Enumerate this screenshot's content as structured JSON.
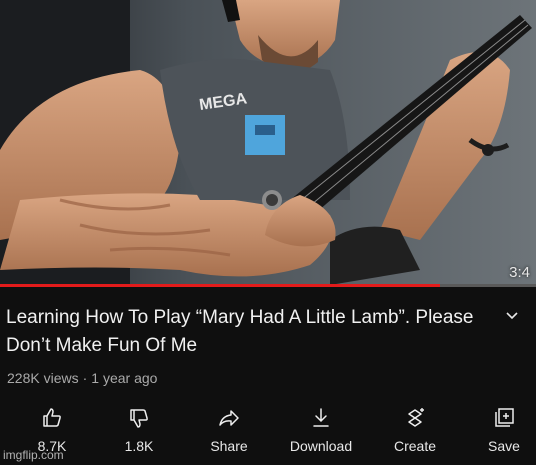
{
  "video": {
    "duration": "3:4",
    "progress": 0.82,
    "shirt_text": "MEGA"
  },
  "title": "Learning How To Play “Mary Had A Little Lamb”. Please Don’t Make Fun Of Me",
  "meta": {
    "views": "228K views",
    "age": "1 year ago"
  },
  "actions": [
    {
      "label": "8.7K",
      "icon": "thumbs-up-icon"
    },
    {
      "label": "1.8K",
      "icon": "thumbs-down-icon"
    },
    {
      "label": "Share",
      "icon": "share-icon"
    },
    {
      "label": "Download",
      "icon": "download-icon"
    },
    {
      "label": "Create",
      "icon": "create-icon"
    },
    {
      "label": "Save",
      "icon": "save-icon"
    }
  ],
  "watermark": "imgflip.com",
  "colors": {
    "background": "#0f0f0f",
    "progress": "#e31b1b",
    "text": "#f1f1f1",
    "subtext": "#aaaaaa"
  }
}
